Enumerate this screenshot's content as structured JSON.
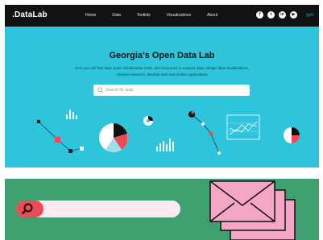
{
  "header": {
    "logo": ".DataLab",
    "nav": [
      "Home",
      "Data",
      "Toolkits",
      "Visualizations",
      "About"
    ],
    "social_icons": [
      "facebook-icon",
      "twitter-icon",
      "linkedin-icon",
      "youtube-icon"
    ],
    "language": "ქარ"
  },
  "hero": {
    "title": "Georgia's Open Data Lab",
    "subtitle_line1": "Here you will find data, basic visualization tools, and resources to analyze data, design data visualizations,",
    "subtitle_line2": "conduct research, develop web and mobile applications",
    "search_placeholder": "Search for data"
  },
  "colors": {
    "navbar": "#121212",
    "hero_bg": "#2ec4dc",
    "bottom_bg": "#3fa06f",
    "accent_red": "#ec4b55",
    "pink": "#f4a6c6"
  }
}
